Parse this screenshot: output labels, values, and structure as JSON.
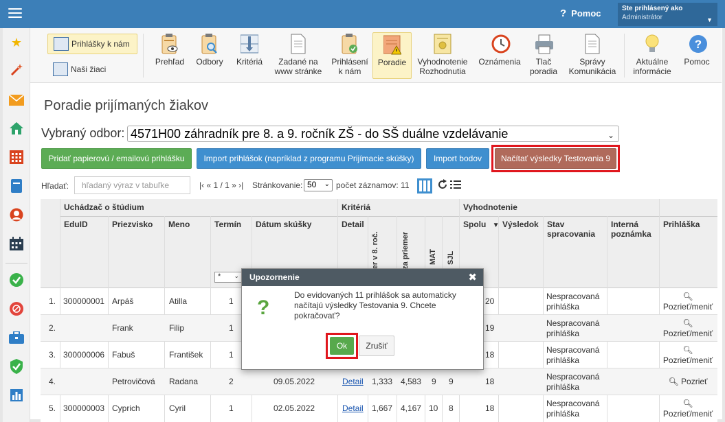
{
  "topbar": {
    "help_label": "Pomoc",
    "user_line1": "Ste prihlásený ako",
    "user_line2": "Administrátor"
  },
  "sidebar": {
    "icons": [
      "star-icon",
      "magic-wand-icon",
      "envelope-icon",
      "home-icon",
      "calendar-grid-icon",
      "notebook-icon",
      "person-icon",
      "calendar-icon",
      "check-circle-icon",
      "no-symbol-icon",
      "briefcase-icon",
      "shield-check-icon",
      "bar-chart-icon"
    ]
  },
  "toolbar": {
    "side": [
      {
        "label": "Prihlášky k nám",
        "active": true
      },
      {
        "label": "Naši žiaci",
        "active": false
      }
    ],
    "items": [
      {
        "label1": "Prehľad",
        "label2": ""
      },
      {
        "label1": "Odbory",
        "label2": ""
      },
      {
        "label1": "Kritériá",
        "label2": ""
      },
      {
        "label1": "Zadané na",
        "label2": "www stránke"
      },
      {
        "label1": "Prihlásení",
        "label2": "k nám"
      },
      {
        "label1": "Poradie",
        "label2": ""
      },
      {
        "label1": "Vyhodnotenie",
        "label2": "Rozhodnutia"
      },
      {
        "label1": "Oznámenia",
        "label2": ""
      },
      {
        "label1": "Tlač",
        "label2": "poradia"
      },
      {
        "label1": "Správy",
        "label2": "Komunikácia"
      },
      {
        "label1": "Aktuálne",
        "label2": "informácie"
      },
      {
        "label1": "Pomoc",
        "label2": ""
      }
    ]
  },
  "page": {
    "title": "Poradie prijímaných žiakov",
    "odbor_label": "Vybraný odbor:",
    "odbor_value": "4571H00 záhradník pre 8. a 9. ročník ZŠ - do SŠ duálne vzdelávanie"
  },
  "actions": {
    "add_paper": "Pridať papierovú / emailovú prihlášku",
    "import_apps": "Import prihlášok (napríklad z programu Prijímacie skúšky)",
    "import_points": "Import bodov",
    "load_results": "Načítať výsledky Testovania 9"
  },
  "search": {
    "label": "Hľadať:",
    "placeholder": "hľadaný výraz v tabuľke"
  },
  "pager": {
    "text": "|‹ « 1 / 1 » ›|",
    "pagesize_label": "Stránkovanie:",
    "pagesize_value": "50",
    "count_text": "počet záznamov: 11"
  },
  "table": {
    "groups": [
      "Uchádzač o štúdium",
      "Kritériá",
      "Vyhodnotenie"
    ],
    "headers": {
      "eduid": "EduID",
      "surname": "Priezvisko",
      "name": "Meno",
      "term": "Termín",
      "exam_date": "Dátum skúšky",
      "detail": "Detail",
      "avg_8": "mer v 8. roč.",
      "avg_total": "y za priemer",
      "mat": "MAT",
      "sjl": "SJL",
      "total": "Spolu",
      "result": "Výsledok",
      "state": "Stav spracovania",
      "note": "Interná poznámka",
      "application": "Prihláška"
    },
    "term_filter": "*",
    "rows": [
      {
        "n": "1.",
        "eduid": "300000001",
        "surname": "Arpáš",
        "name": "Atilla",
        "term": "1",
        "date": "",
        "detail": "",
        "c1": "",
        "c2": "",
        "mat": "",
        "sjl": "",
        "total": "20",
        "state": "Nespracovaná prihláška",
        "app": "Pozrieť/meniť"
      },
      {
        "n": "2.",
        "eduid": "",
        "surname": "Frank",
        "name": "Filip",
        "term": "1",
        "date": "",
        "detail": "",
        "c1": "",
        "c2": "",
        "mat": "",
        "sjl": "",
        "total": "19",
        "state": "Nespracovaná prihláška",
        "app": "Pozrieť/meniť"
      },
      {
        "n": "3.",
        "eduid": "300000006",
        "surname": "Fabuš",
        "name": "František",
        "term": "1",
        "date": "",
        "detail": "",
        "c1": "",
        "c2": "",
        "mat": "",
        "sjl": "",
        "total": "18",
        "state": "Nespracovaná prihláška",
        "app": "Pozrieť/meniť"
      },
      {
        "n": "4.",
        "eduid": "",
        "surname": "Petrovičová",
        "name": "Radana",
        "term": "2",
        "date": "09.05.2022",
        "detail": "Detail",
        "c1": "1,333",
        "c2": "4,583",
        "mat": "9",
        "sjl": "9",
        "total": "18",
        "state": "Nespracovaná prihláška",
        "app": "Pozrieť"
      },
      {
        "n": "5.",
        "eduid": "300000003",
        "surname": "Cyprich",
        "name": "Cyril",
        "term": "1",
        "date": "02.05.2022",
        "detail": "Detail",
        "c1": "1,667",
        "c2": "4,167",
        "mat": "10",
        "sjl": "8",
        "total": "18",
        "state": "Nespracovaná prihláška",
        "app": "Pozrieť/meniť"
      }
    ]
  },
  "modal": {
    "title": "Upozornenie",
    "message": "Do evidovaných 11 prihlášok sa automaticky načítajú výsledky Testovania 9. Chcete pokračovať?",
    "ok": "Ok",
    "cancel": "Zrušiť"
  },
  "colors": {
    "topbar": "#3c7fb8",
    "green": "#5cac55",
    "blue": "#3f8fcf",
    "brown": "#b06a5b",
    "highlight_red": "#e0161d"
  }
}
